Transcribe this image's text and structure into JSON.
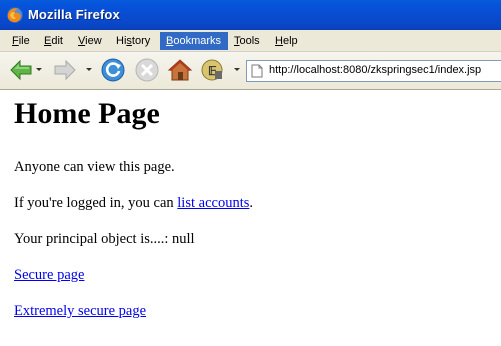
{
  "window": {
    "title": "Mozilla Firefox",
    "app_icon": "firefox-icon"
  },
  "menubar": {
    "items": [
      {
        "key": "F",
        "rest": "ile"
      },
      {
        "key": "E",
        "rest": "dit"
      },
      {
        "key": "V",
        "rest": "iew"
      },
      {
        "pre": "Hi",
        "key": "s",
        "rest": "tory"
      },
      {
        "key": "B",
        "rest": "ookmarks"
      },
      {
        "key": "T",
        "rest": "ools"
      },
      {
        "key": "H",
        "rest": "elp"
      }
    ],
    "active_item": "Bookmarks"
  },
  "toolbar": {
    "icons": [
      "back-icon",
      "forward-icon",
      "reload-icon",
      "stop-icon",
      "home-icon",
      "addon-icon"
    ],
    "url": "http://localhost:8080/zkspringsec1/index.jsp",
    "page_icon": "page-icon"
  },
  "page": {
    "heading": "Home Page",
    "p1": "Anyone can view this page.",
    "p2_prefix": "If you're logged in, you can ",
    "p2_link": "list accounts",
    "p2_suffix": ".",
    "p3": "Your principal object is....: null",
    "link_secure": "Secure page",
    "link_extreme": "Extremely secure page"
  },
  "colors": {
    "titlebar": "#0a4cd0",
    "menu_active": "#316ac5",
    "link": "#0000ee"
  }
}
